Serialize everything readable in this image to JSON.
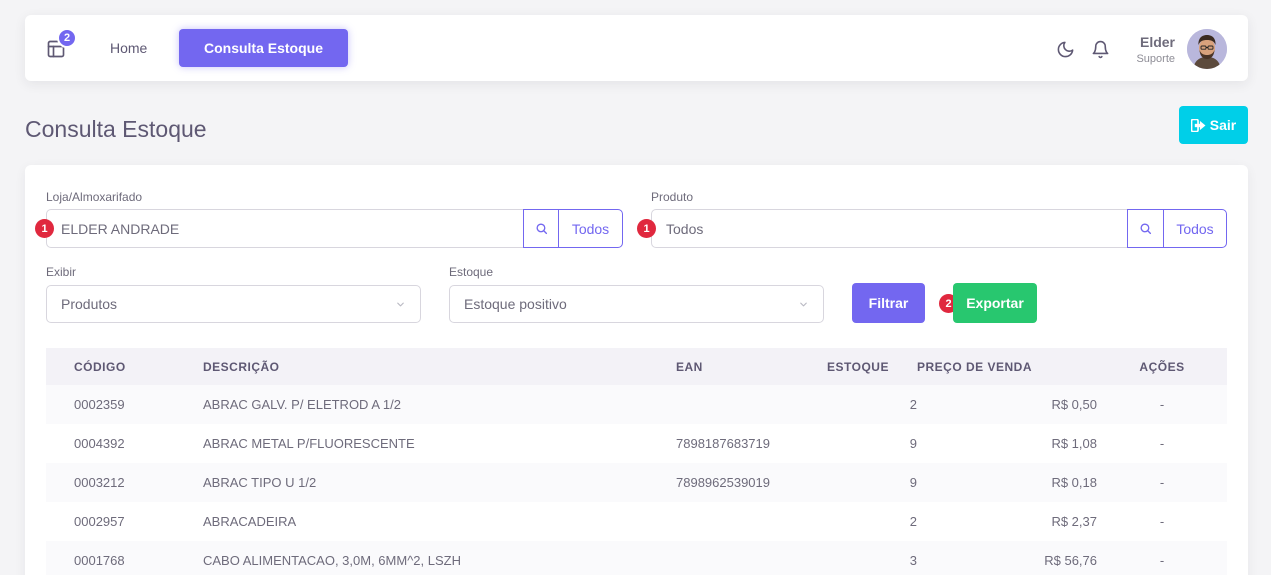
{
  "nav": {
    "badge_count": "2",
    "home_label": "Home",
    "active_label": "Consulta Estoque",
    "user_name": "Elder",
    "user_role": "Suporte"
  },
  "page": {
    "title": "Consulta Estoque",
    "exit_label": "Sair"
  },
  "filters": {
    "loja_label": "Loja/Almoxarifado",
    "loja_value": "ELDER ANDRADE",
    "loja_badge": "1",
    "loja_todos": "Todos",
    "produto_label": "Produto",
    "produto_value": "Todos",
    "produto_badge": "1",
    "produto_todos": "Todos",
    "exibir_label": "Exibir",
    "exibir_value": "Produtos",
    "estoque_label": "Estoque",
    "estoque_value": "Estoque positivo",
    "filtrar_label": "Filtrar",
    "exportar_badge": "2",
    "exportar_label": "Exportar"
  },
  "table": {
    "headers": [
      "CÓDIGO",
      "DESCRIÇÃO",
      "EAN",
      "ESTOQUE",
      "PREÇO DE VENDA",
      "AÇÕES"
    ],
    "rows": [
      [
        "0002359",
        "ABRAC GALV. P/ ELETROD A 1/2",
        "",
        "2",
        "R$ 0,50",
        "-"
      ],
      [
        "0004392",
        "ABRAC METAL P/FLUORESCENTE",
        "7898187683719",
        "9",
        "R$ 1,08",
        "-"
      ],
      [
        "0003212",
        "ABRAC TIPO U 1/2",
        "7898962539019",
        "9",
        "R$ 0,18",
        "-"
      ],
      [
        "0002957",
        "ABRACADEIRA",
        "",
        "2",
        "R$ 2,37",
        "-"
      ],
      [
        "0001768",
        "CABO ALIMENTACAO, 3,0M, 6MM^2, LSZH",
        "",
        "3",
        "R$ 56,76",
        "-"
      ]
    ]
  },
  "colors": {
    "primary": "#7367f0",
    "info": "#00cfe8",
    "success": "#28c76f",
    "danger": "#e0283e"
  },
  "icons": {
    "layout": "layout-icon",
    "moon": "moon-icon",
    "bell": "bell-icon",
    "search": "search-icon",
    "exit": "sign-out-icon",
    "chevron": "chevron-down-icon"
  }
}
